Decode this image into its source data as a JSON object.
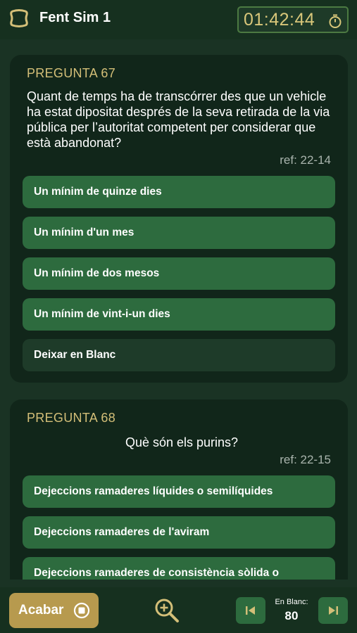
{
  "header": {
    "app_icon": "badge-icon",
    "title": "Fent Sim 1",
    "timer": "01:42:44",
    "timer_icon": "stopwatch-icon"
  },
  "questions": [
    {
      "label": "PREGUNTA 67",
      "text": "Quant de temps ha de transcórrer des que un vehicle ha estat dipositat després de la seva retirada de la via pública per l’autoritat competent per considerar que està abandonat?",
      "ref": "ref: 22-14",
      "options": [
        "Un mínim de quinze dies",
        "Un mínim d'un mes",
        "Un mínim de dos mesos",
        "Un mínim de vint-i-un dies"
      ],
      "blank_option": "Deixar en Blanc"
    },
    {
      "label": "PREGUNTA 68",
      "text": "Què són els purins?",
      "ref": "ref: 22-15",
      "options": [
        "Dejeccions ramaderes líquides o semilíquides",
        "Dejeccions ramaderes de l'aviram",
        "Dejeccions ramaderes de consistència sòlida o"
      ]
    }
  ],
  "footer": {
    "finish_label": "Acabar",
    "finish_icon": "stop-circle-icon",
    "zoom_icon": "zoom-in-icon",
    "prev_icon": "skip-previous-icon",
    "next_icon": "skip-next-icon",
    "blank_label": "En Blanc:",
    "blank_count": "80"
  },
  "colors": {
    "background": "#1a3324",
    "card": "#11261a",
    "option": "#2d6b3e",
    "accent_gold": "#b79a4e",
    "label_gold": "#d4bf78"
  }
}
